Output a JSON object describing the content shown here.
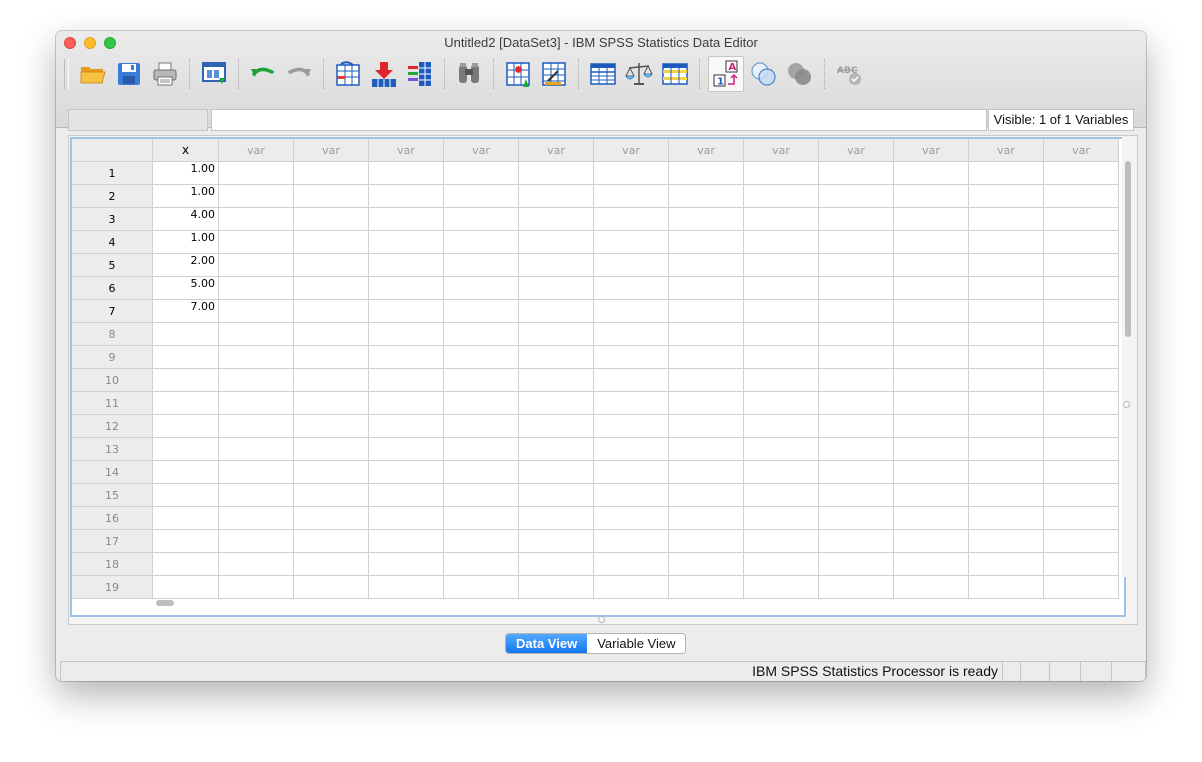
{
  "window": {
    "title": "Untitled2 [DataSet3] - IBM SPSS Statistics Data Editor"
  },
  "toolbar": {
    "icons": [
      "open-folder-icon",
      "save-icon",
      "print-icon",
      "recall-dialog-icon",
      "undo-icon",
      "redo-icon",
      "go-to-case-icon",
      "go-to-variable-icon",
      "variables-icon",
      "find-icon",
      "insert-cases-icon",
      "insert-variable-icon",
      "split-file-icon",
      "weight-cases-icon",
      "select-cases-icon",
      "value-labels-icon",
      "use-variable-sets-icon",
      "show-all-variables-icon",
      "spell-check-icon"
    ]
  },
  "editbar": {
    "cell_reference": "",
    "cell_value": "",
    "visible_info": "Visible: 1 of 1 Variables"
  },
  "grid": {
    "columns": [
      "x",
      "var",
      "var",
      "var",
      "var",
      "var",
      "var",
      "var",
      "var",
      "var",
      "var",
      "var",
      "var"
    ],
    "defined_columns": 1,
    "rows": [
      {
        "num": "1",
        "cells": [
          "1.00"
        ]
      },
      {
        "num": "2",
        "cells": [
          "1.00"
        ]
      },
      {
        "num": "3",
        "cells": [
          "4.00"
        ]
      },
      {
        "num": "4",
        "cells": [
          "1.00"
        ]
      },
      {
        "num": "5",
        "cells": [
          "2.00"
        ]
      },
      {
        "num": "6",
        "cells": [
          "5.00"
        ]
      },
      {
        "num": "7",
        "cells": [
          "7.00"
        ]
      },
      {
        "num": "8",
        "cells": []
      },
      {
        "num": "9",
        "cells": []
      },
      {
        "num": "10",
        "cells": []
      },
      {
        "num": "11",
        "cells": []
      },
      {
        "num": "12",
        "cells": []
      },
      {
        "num": "13",
        "cells": []
      },
      {
        "num": "14",
        "cells": []
      },
      {
        "num": "15",
        "cells": []
      },
      {
        "num": "16",
        "cells": []
      },
      {
        "num": "17",
        "cells": []
      },
      {
        "num": "18",
        "cells": []
      },
      {
        "num": "19",
        "cells": []
      }
    ],
    "defined_rows": 7
  },
  "tabs": {
    "data_view": "Data View",
    "variable_view": "Variable View"
  },
  "status": {
    "text": "IBM SPSS Statistics Processor is ready"
  },
  "colors": {
    "active_tab": "#1176f0",
    "grid_border": "#9dc4e6",
    "header_bg": "#ececec"
  }
}
